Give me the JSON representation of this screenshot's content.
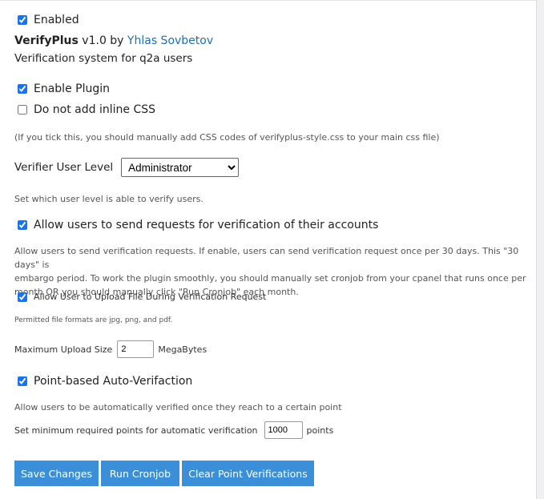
{
  "enabled": {
    "label": "Enabled",
    "checked": true
  },
  "plugin": {
    "name": "VerifyPlus",
    "version": "v1.0 by",
    "author": "Yhlas Sovbetov",
    "description": "Verification system for q2a users"
  },
  "options": {
    "enable_plugin": {
      "label": "Enable Plugin",
      "checked": true
    },
    "no_inline_css": {
      "label": "Do not add inline CSS",
      "checked": false
    },
    "inline_css_note": "(If you tick this, you should manually add CSS codes of verifyplus-style.css to your main css file)",
    "verifier_level": {
      "label": "Verifier User Level",
      "selected": "Administrator",
      "note": "Set which user level is able to verify users."
    },
    "allow_requests": {
      "label": "Allow users to send requests for verification of their accounts",
      "checked": true,
      "note_line1": "Allow users to send verification requests. If enable, users can send verification request once per 30 days. This \"30 days\" is",
      "note_line2": "embargo period. To work the plugin smoothly, you should manually set cronjob from your cpanel that runs once per",
      "note_line3": "month OR you should manually click \"Run Cronjob\" each month."
    },
    "allow_upload": {
      "label": "Allow User to Upload File During Verification Request",
      "checked": true,
      "note": "Permitted file formats are jpg, png, and pdf."
    },
    "max_upload": {
      "label": "Maximum Upload Size",
      "value": "2",
      "unit": "MegaBytes"
    },
    "point_auto": {
      "label": "Point-based Auto-Verifaction",
      "checked": true,
      "note": "Allow users to be automatically verified once they reach to a certain point"
    },
    "min_points": {
      "label": "Set minimum required points for automatic verification",
      "value": "1000",
      "unit": "points"
    }
  },
  "buttons": {
    "save": "Save Changes",
    "cron": "Run Cronjob",
    "clear": "Clear Point Verifications"
  },
  "colors": {
    "accent": "#3b8fd9",
    "link": "#1f6fb0"
  }
}
